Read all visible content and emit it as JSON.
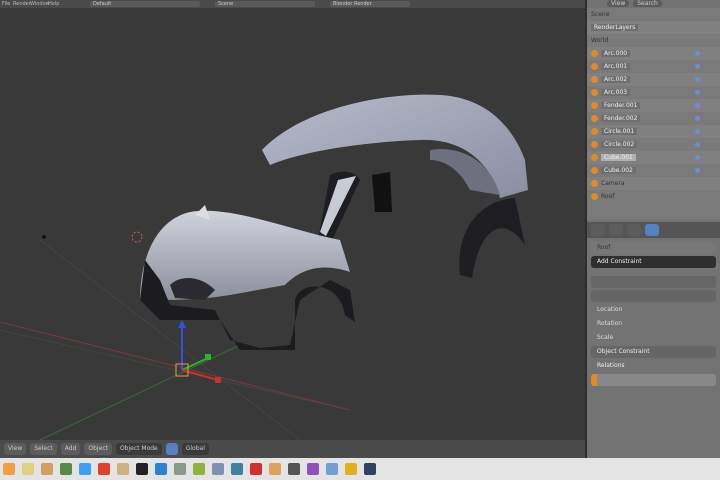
{
  "topbar": {
    "menus": [
      "File",
      "Render",
      "Window",
      "Help"
    ],
    "layout": "Default",
    "scene": "Scene",
    "engine": "Blender Render"
  },
  "viewport_header": {
    "menus": [
      "View",
      "Select",
      "Add",
      "Object"
    ],
    "mode": "Object Mode",
    "pivot": "Global"
  },
  "outliner": {
    "tabs": [
      "View",
      "Search"
    ],
    "items": [
      "Scene",
      "RenderLayers",
      "World",
      "Arc.000",
      "Arc.001",
      "Arc.002",
      "Arc.003",
      "Fender.001",
      "Fender.002",
      "Circle.001",
      "Circle.002",
      "Cube.001",
      "Cube.002",
      "Camera",
      "Roof"
    ]
  },
  "properties": {
    "section": "Add Constraint",
    "selected": "Roof",
    "fields": [
      "Location",
      "Rotation",
      "Scale"
    ],
    "dropdown": "Object Constraint",
    "label": "Relations"
  },
  "colors": {
    "accent": "#5680c2",
    "object": "#e08a2a",
    "x_axis": "#c83030",
    "y_axis": "#30b030",
    "z_axis": "#3050e0"
  },
  "taskbar": {
    "icons": [
      "files",
      "notes",
      "folder",
      "terminal",
      "settings",
      "mail",
      "browser",
      "image",
      "music",
      "monitor",
      "chart",
      "sheet",
      "book",
      "calc",
      "disk",
      "photo",
      "store",
      "video",
      "camera",
      "chat"
    ]
  }
}
